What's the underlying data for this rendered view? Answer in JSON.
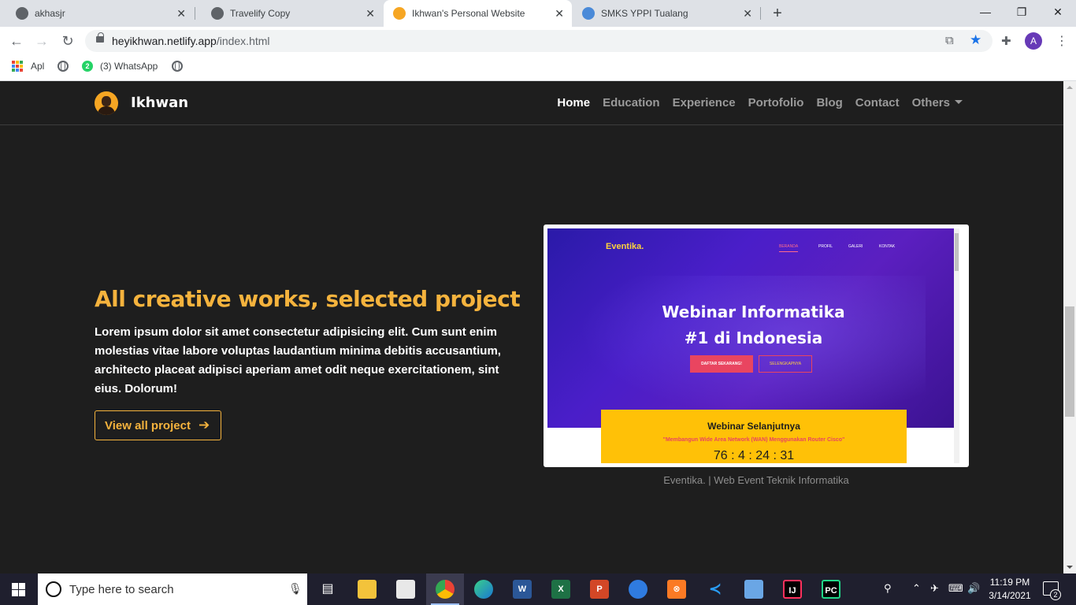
{
  "browser": {
    "tabs": [
      {
        "title": "akhasjr",
        "active": false
      },
      {
        "title": "Travelify Copy",
        "active": false
      },
      {
        "title": "Ikhwan's Personal Website",
        "active": true
      },
      {
        "title": "SMKS YPPI Tualang",
        "active": false
      }
    ],
    "new_tab": "+",
    "window_controls": {
      "minimize": "—",
      "restore": "❐",
      "close": "✕"
    },
    "nav": {
      "back": "←",
      "forward": "→",
      "reload": "↻"
    },
    "url": {
      "host": "heyikhwan.netlify.app",
      "path": "/index.html"
    },
    "profile_initial": "A",
    "bookmarks": [
      {
        "label": "Apl",
        "icon": "apps-grid-icon"
      },
      {
        "label": "",
        "icon": "globe-icon"
      },
      {
        "label": "(3) WhatsApp",
        "icon": "whatsapp-icon",
        "badge": "2"
      },
      {
        "label": "",
        "icon": "globe-icon"
      }
    ]
  },
  "site": {
    "brand": "Ikhwan",
    "nav": [
      "Home",
      "Education",
      "Experience",
      "Portofolio",
      "Blog",
      "Contact",
      "Others"
    ],
    "active_nav": "Home",
    "hero": {
      "title": "All creative works, selected project",
      "text": "Lorem ipsum dolor sit amet consectetur adipisicing elit. Cum sunt enim molestias vitae labore voluptas laudantium minima debitis accusantium, architecto placeat adipisci aperiam amet odit neque exercitationem, sint eius. Dolorum!",
      "button": "View all project",
      "button_arrow": "➔"
    },
    "preview": {
      "logo": "Eventika.",
      "menu": [
        "BERANDA",
        "PROFIL",
        "GALERI",
        "KONTAK"
      ],
      "headline_1": "Webinar Informatika",
      "headline_2": "#1 di Indonesia",
      "btn_primary": "DAFTAR SEKARANG!",
      "btn_secondary": "SELENGKAPNYA",
      "card_title": "Webinar Selanjutnya",
      "card_subtitle": "\"Membangun Wide Area Network (WAN) Menggunakan Router Cisco\"",
      "countdown": "76 : 4 : 24 : 31"
    },
    "caption": "Eventika. | Web Event Teknik Informatika",
    "colors": {
      "accent": "#f5b33d",
      "background": "#1e1e1e"
    }
  },
  "taskbar": {
    "search_placeholder": "Type here to search",
    "apps": [
      "task-view",
      "file-explorer",
      "microsoft-store",
      "chrome",
      "edge",
      "word",
      "excel",
      "powerpoint",
      "ms-paint-3d",
      "xampp",
      "vscode",
      "virtualbox",
      "intellij",
      "pycharm"
    ],
    "clock_time": "11:19 PM",
    "clock_date": "3/14/2021",
    "notifications": "2"
  }
}
